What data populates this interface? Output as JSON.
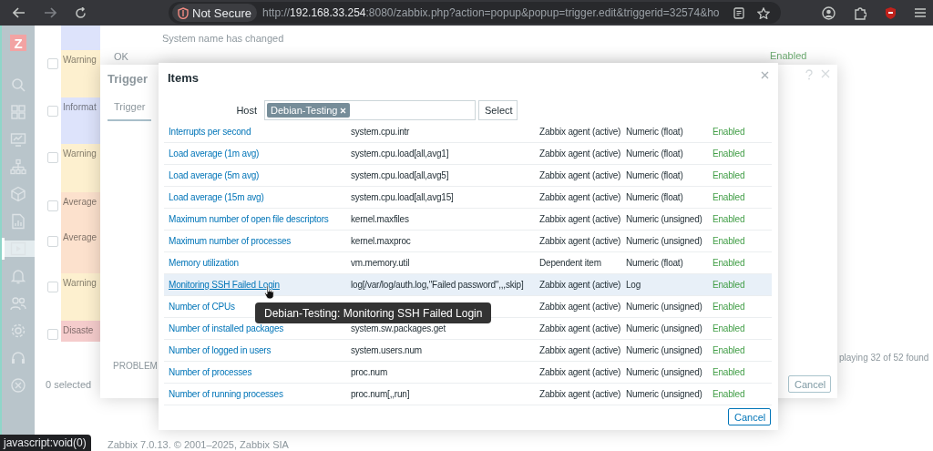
{
  "browser": {
    "security_label": "Not Secure",
    "url": {
      "scheme": "http://",
      "host": "192.168.33.254",
      "rest": ":8080/zabbix.php?action=popup&popup=trigger.edit&triggerid=32574&ho"
    }
  },
  "sidebar": {
    "logo": "Z",
    "items": [
      {
        "selected": false
      },
      {
        "selected": false
      },
      {
        "selected": false
      },
      {
        "selected": false
      },
      {
        "selected": false
      },
      {
        "selected": false
      },
      {
        "selected": true
      },
      {
        "selected": false
      },
      {
        "selected": false
      },
      {
        "selected": false
      },
      {
        "selected": false
      },
      {
        "selected": false
      }
    ]
  },
  "background": {
    "rows": [
      {
        "color": "#dde3fb",
        "message": "System name has changed"
      },
      {
        "severity": "Warning",
        "color": "#fdf0cf",
        "status": "OK",
        "enabled": "Enabled",
        "checked": false
      },
      {
        "severity": "Informat",
        "color": "#dde3fb",
        "checked": false
      },
      {
        "severity": "Warning",
        "color": "#fdf0cf",
        "checked": false
      },
      {
        "severity": "Average",
        "color": "#fce1cd",
        "checked": false
      },
      {
        "severity": "Average",
        "color": "#fce1cd",
        "checked": false
      },
      {
        "severity": "Warning",
        "color": "#fdf0cf",
        "checked": false
      },
      {
        "severity": "Disaste",
        "color": "#f5cccc",
        "checked": false
      }
    ],
    "displaying": "playing 32 of 52 found",
    "selected_count": "0 selected",
    "footer": "Zabbix 7.0.13. © 2001–2025, Zabbix SIA"
  },
  "trigger_dialog": {
    "title": "Trigger",
    "tabs": [
      {
        "label": "Trigger",
        "selected": true
      }
    ],
    "field_label": "PROBLEM",
    "buttons": [
      "Cancel"
    ]
  },
  "items_dialog": {
    "title": "Items",
    "host": {
      "label": "Host",
      "chips": [
        "Debian-Testing"
      ],
      "button": "Select"
    },
    "rows": [
      {
        "name": "Interrupts per second",
        "key": "system.cpu.intr",
        "type": "Zabbix agent (active)",
        "value_type": "Numeric (float)",
        "status": "Enabled",
        "hovered": false
      },
      {
        "name": "Load average (1m avg)",
        "key": "system.cpu.load[all,avg1]",
        "type": "Zabbix agent (active)",
        "value_type": "Numeric (float)",
        "status": "Enabled",
        "hovered": false
      },
      {
        "name": "Load average (5m avg)",
        "key": "system.cpu.load[all,avg5]",
        "type": "Zabbix agent (active)",
        "value_type": "Numeric (float)",
        "status": "Enabled",
        "hovered": false
      },
      {
        "name": "Load average (15m avg)",
        "key": "system.cpu.load[all,avg15]",
        "type": "Zabbix agent (active)",
        "value_type": "Numeric (float)",
        "status": "Enabled",
        "hovered": false
      },
      {
        "name": "Maximum number of open file descriptors",
        "key": "kernel.maxfiles",
        "type": "Zabbix agent (active)",
        "value_type": "Numeric (unsigned)",
        "status": "Enabled",
        "hovered": false
      },
      {
        "name": "Maximum number of processes",
        "key": "kernel.maxproc",
        "type": "Zabbix agent (active)",
        "value_type": "Numeric (unsigned)",
        "status": "Enabled",
        "hovered": false
      },
      {
        "name": "Memory utilization",
        "key": "vm.memory.util",
        "type": "Dependent item",
        "value_type": "Numeric (float)",
        "status": "Enabled",
        "hovered": false
      },
      {
        "name": "Monitoring SSH Failed Login",
        "key": "log[/var/log/auth.log,\"Failed password\",,,skip]",
        "type": "Zabbix agent (active)",
        "value_type": "Log",
        "status": "Enabled",
        "hovered": true
      },
      {
        "name": "Number of CPUs",
        "type": "Zabbix agent (active)",
        "value_type": "Numeric (unsigned)",
        "status": "Enabled",
        "hovered": false
      },
      {
        "name": "Number of installed packages",
        "key": "system.sw.packages.get",
        "type": "Zabbix agent (active)",
        "value_type": "Numeric (unsigned)",
        "status": "Enabled",
        "hovered": false
      },
      {
        "name": "Number of logged in users",
        "key": "system.users.num",
        "type": "Zabbix agent (active)",
        "value_type": "Numeric (unsigned)",
        "status": "Enabled",
        "hovered": false
      },
      {
        "name": "Number of processes",
        "key": "proc.num",
        "type": "Zabbix agent (active)",
        "value_type": "Numeric (unsigned)",
        "status": "Enabled",
        "hovered": false
      },
      {
        "name": "Number of running processes",
        "key": "proc.num[,,run]",
        "type": "Zabbix agent (active)",
        "value_type": "Numeric (unsigned)",
        "status": "Enabled",
        "hovered": false
      }
    ],
    "tooltip": "Debian-Testing: Monitoring SSH Failed Login",
    "buttons": [
      "Cancel"
    ]
  },
  "status_bar": "javascript:void(0)"
}
